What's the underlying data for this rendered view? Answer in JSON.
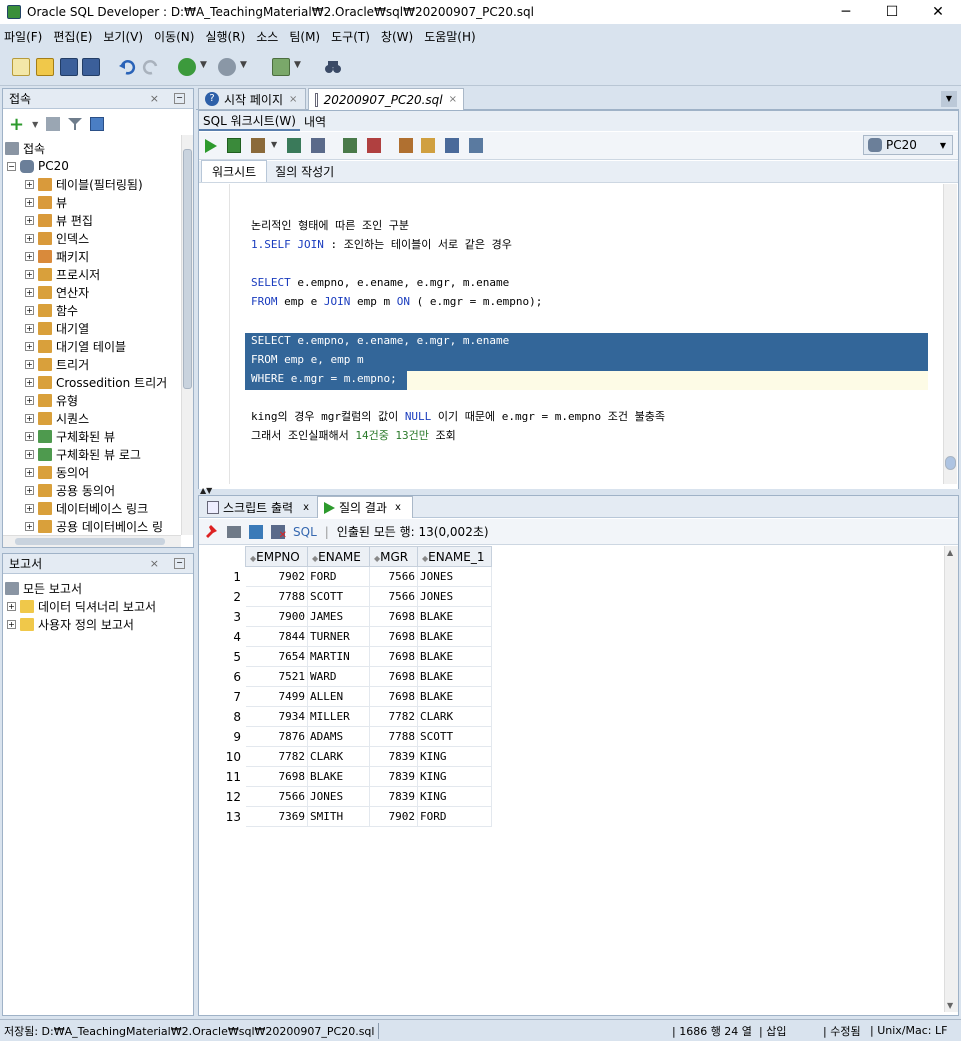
{
  "window": {
    "title": "Oracle SQL Developer : D:₩A_TeachingMaterial₩2.Oracle₩sql₩20200907_PC20.sql",
    "min": "─",
    "max": "☐",
    "close": "✕"
  },
  "menu": [
    "파일(F)",
    "편집(E)",
    "보기(V)",
    "이동(N)",
    "실행(R)",
    "소스",
    "팀(M)",
    "도구(T)",
    "창(W)",
    "도움말(H)"
  ],
  "connections": {
    "pane_title": "접속",
    "root_label": "접속",
    "db": "PC20",
    "items": [
      "테이블(필터링됨)",
      "뷰",
      "뷰 편집",
      "인덱스",
      "패키지",
      "프로시저",
      "연산자",
      "함수",
      "대기열",
      "대기열 테이블",
      "트리거",
      "Crossedition 트리거",
      "유형",
      "시퀀스",
      "구체화된 뷰",
      "구체화된 뷰 로그",
      "동의어",
      "공용 동의어",
      "데이터베이스 링크",
      "공용 데이터베이스 링"
    ]
  },
  "reports": {
    "pane_title": "보고서",
    "root": "모든 보고서",
    "items": [
      "데이터 딕셔너리 보고서",
      "사용자 정의 보고서"
    ]
  },
  "editor": {
    "tabs": [
      "시작 페이지",
      "20200907_PC20.sql"
    ],
    "subtabs": [
      "SQL 워크시트(W)",
      "내역"
    ],
    "connection": "PC20",
    "worktabs": [
      "워크시트",
      "질의 작성기"
    ],
    "lines": [
      "논리적인 형태에 따른 조인 구분",
      "1.SELF JOIN : 조인하는 테이블이 서로 같은 경우",
      "SELECT e.empno, e.ename, e.mgr, m.ename",
      "FROM emp e JOIN emp m ON ( e.mgr = m.empno);",
      "SELECT e.empno, e.ename, e.mgr, m.ename",
      "FROM emp e, emp m",
      "WHERE e.mgr = m.empno;",
      "king의 경우 mgr컬럼의 값이 NULL 이기 때문에 e.mgr = m.empno 조건 불충족",
      "그래서 조인실패해서 14건중 13건만 조회"
    ]
  },
  "output": {
    "tabs": [
      "스크립트 출력",
      "질의 결과"
    ],
    "tab_close": "x",
    "sql_label": "SQL",
    "fetched": "인출된 모든 행: 13(0,002초)",
    "columns": [
      "EMPNO",
      "ENAME",
      "MGR",
      "ENAME_1"
    ],
    "rows": [
      [
        "1",
        "7902",
        "FORD",
        "7566",
        "JONES"
      ],
      [
        "2",
        "7788",
        "SCOTT",
        "7566",
        "JONES"
      ],
      [
        "3",
        "7900",
        "JAMES",
        "7698",
        "BLAKE"
      ],
      [
        "4",
        "7844",
        "TURNER",
        "7698",
        "BLAKE"
      ],
      [
        "5",
        "7654",
        "MARTIN",
        "7698",
        "BLAKE"
      ],
      [
        "6",
        "7521",
        "WARD",
        "7698",
        "BLAKE"
      ],
      [
        "7",
        "7499",
        "ALLEN",
        "7698",
        "BLAKE"
      ],
      [
        "8",
        "7934",
        "MILLER",
        "7782",
        "CLARK"
      ],
      [
        "9",
        "7876",
        "ADAMS",
        "7788",
        "SCOTT"
      ],
      [
        "10",
        "7782",
        "CLARK",
        "7839",
        "KING"
      ],
      [
        "11",
        "7698",
        "BLAKE",
        "7839",
        "KING"
      ],
      [
        "12",
        "7566",
        "JONES",
        "7839",
        "KING"
      ],
      [
        "13",
        "7369",
        "SMITH",
        "7902",
        "FORD"
      ]
    ]
  },
  "status": {
    "path": "저장됨: D:₩A_TeachingMaterial₩2.Oracle₩sql₩20200907_PC20.sql",
    "position": "1686 행 24 열",
    "mode": "삽입",
    "modified": "수정됨",
    "eol": "Unix/Mac: LF"
  },
  "colors": {
    "accent": "#336699",
    "selection": "#336699",
    "keyword": "#1a3cbe",
    "number": "#2a7a2a",
    "current_line": "#fdfbe6"
  }
}
